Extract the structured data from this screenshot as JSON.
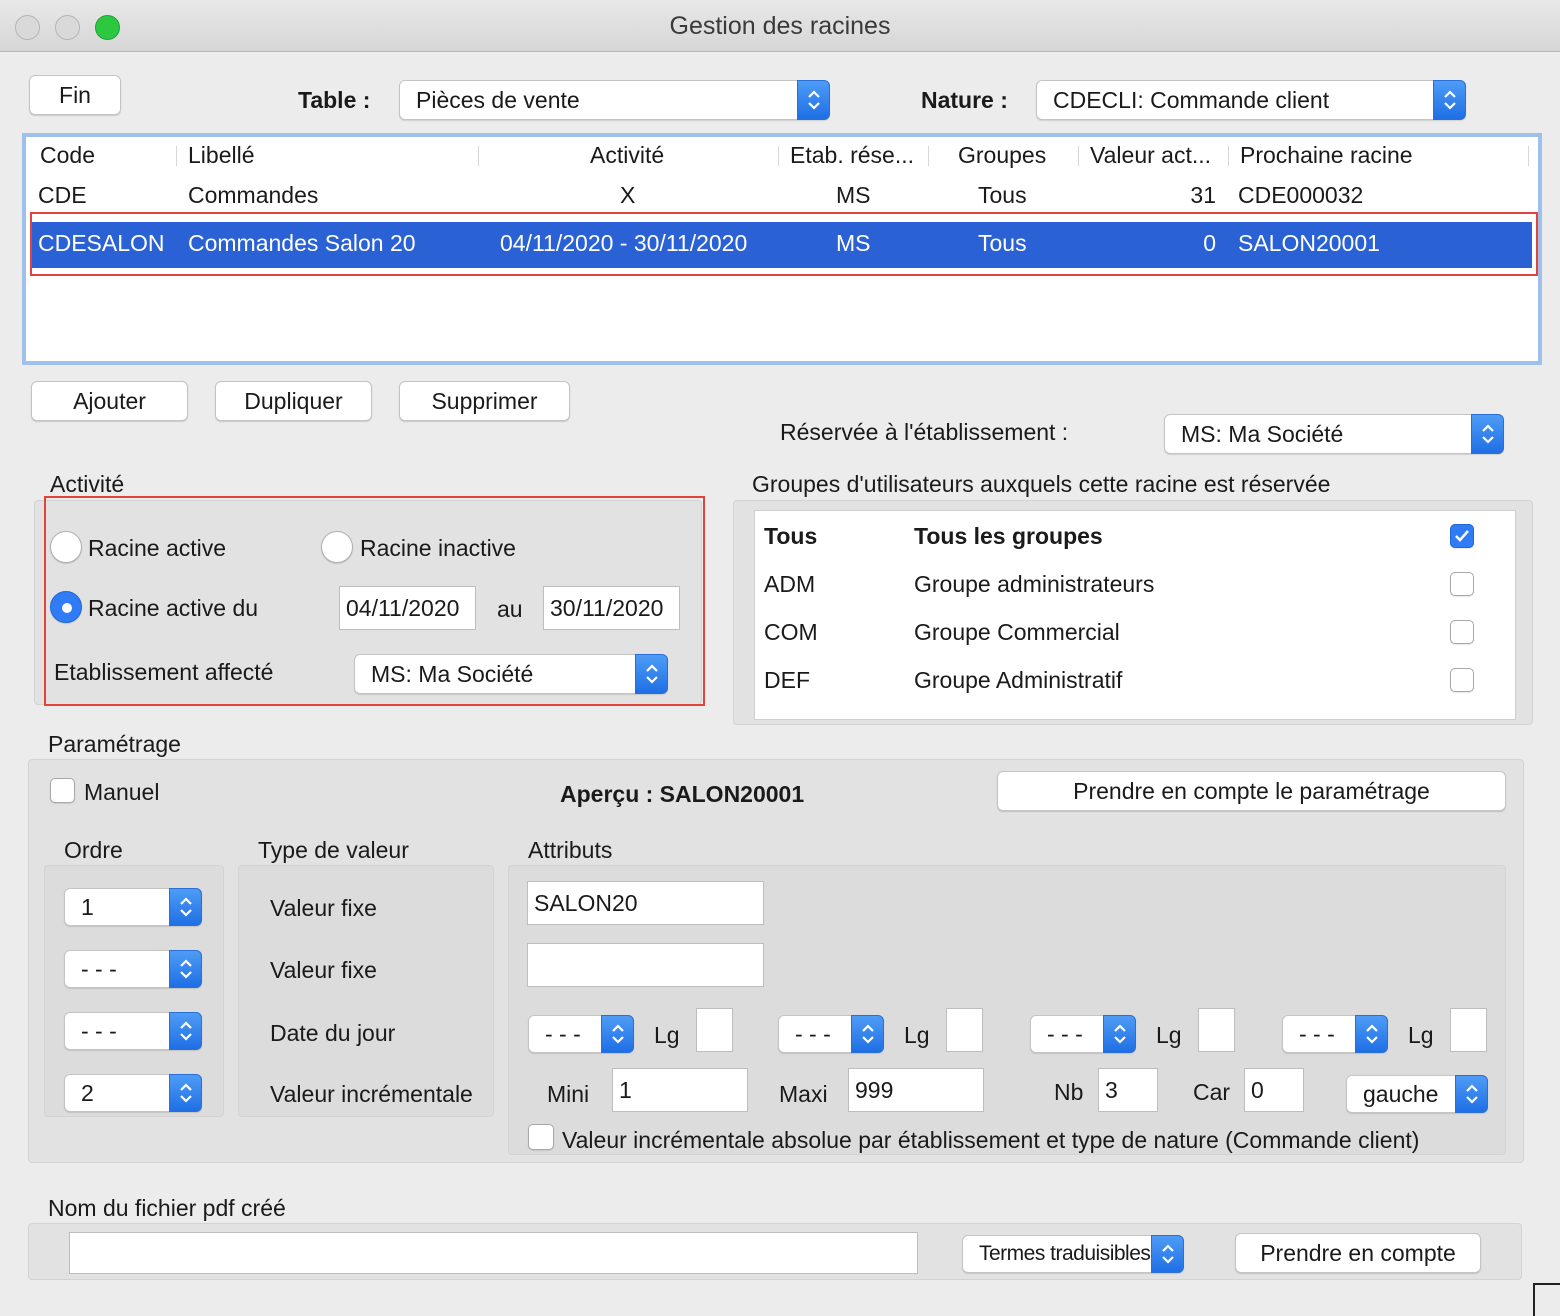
{
  "window": {
    "title": "Gestion des racines"
  },
  "toolbar": {
    "fin_label": "Fin",
    "table_label": "Table :",
    "table_value": "Pièces de vente",
    "nature_label": "Nature :",
    "nature_value": "CDECLI: Commande client"
  },
  "list": {
    "headers": [
      "Code",
      "Libellé",
      "Activité",
      "Etab. rése...",
      "Groupes",
      "Valeur act...",
      "Prochaine racine"
    ],
    "rows": [
      {
        "code": "CDE",
        "libelle": "Commandes",
        "activite": "X",
        "etab": "MS",
        "groupes": "Tous",
        "valeur": "31",
        "prochaine": "CDE000032"
      },
      {
        "code": "CDESALON",
        "libelle": "Commandes Salon 20",
        "activite": "04/11/2020 - 30/11/2020",
        "etab": "MS",
        "groupes": "Tous",
        "valeur": "0",
        "prochaine": "SALON20001"
      }
    ]
  },
  "actions": {
    "ajouter": "Ajouter",
    "dupliquer": "Dupliquer",
    "supprimer": "Supprimer"
  },
  "reservee": {
    "label": "Réservée à l'établissement :",
    "value": "MS: Ma Société"
  },
  "activite": {
    "title": "Activité",
    "racine_active": "Racine active",
    "racine_inactive": "Racine inactive",
    "racine_active_du": "Racine active du",
    "date_from": "04/11/2020",
    "au": "au",
    "date_to": "30/11/2020",
    "etab_label": "Etablissement affecté",
    "etab_value": "MS: Ma Société"
  },
  "groupes": {
    "title": "Groupes d'utilisateurs auxquels cette racine est réservée",
    "rows": [
      {
        "code": "Tous",
        "name": "Tous les groupes",
        "checked": true
      },
      {
        "code": "ADM",
        "name": "Groupe administrateurs",
        "checked": false
      },
      {
        "code": "COM",
        "name": "Groupe Commercial",
        "checked": false
      },
      {
        "code": "DEF",
        "name": "Groupe Administratif",
        "checked": false
      }
    ]
  },
  "parametrage": {
    "title": "Paramétrage",
    "manuel": "Manuel",
    "apercu": "Aperçu : SALON20001",
    "prendre_btn": "Prendre en compte le paramétrage",
    "ordre_title": "Ordre",
    "ordre": [
      "1",
      "- - -",
      "- - -",
      "2"
    ],
    "type_title": "Type de valeur",
    "types": [
      "Valeur fixe",
      "Valeur fixe",
      "Date du jour",
      "Valeur incrémentale"
    ],
    "attributs_title": "Attributs",
    "attr1": "SALON20",
    "attr2": "",
    "date_selects": [
      "- - -",
      "- - -",
      "- - -",
      "- - -"
    ],
    "lg_label": "Lg",
    "mini_label": "Mini",
    "mini_value": "1",
    "maxi_label": "Maxi",
    "maxi_value": "999",
    "nb_label": "Nb",
    "nb_value": "3",
    "car_label": "Car",
    "car_value": "0",
    "align_value": "gauche",
    "absolute_label": "Valeur incrémentale absolue par établissement et type de nature (Commande client)"
  },
  "pdf": {
    "title": "Nom du fichier pdf créé",
    "value": "",
    "termes": "Termes traduisibles",
    "prendre": "Prendre en compte"
  },
  "colors": {
    "accent": "#2a62d6",
    "highlight": "#e2443a",
    "listborder": "#9ec0ea"
  }
}
